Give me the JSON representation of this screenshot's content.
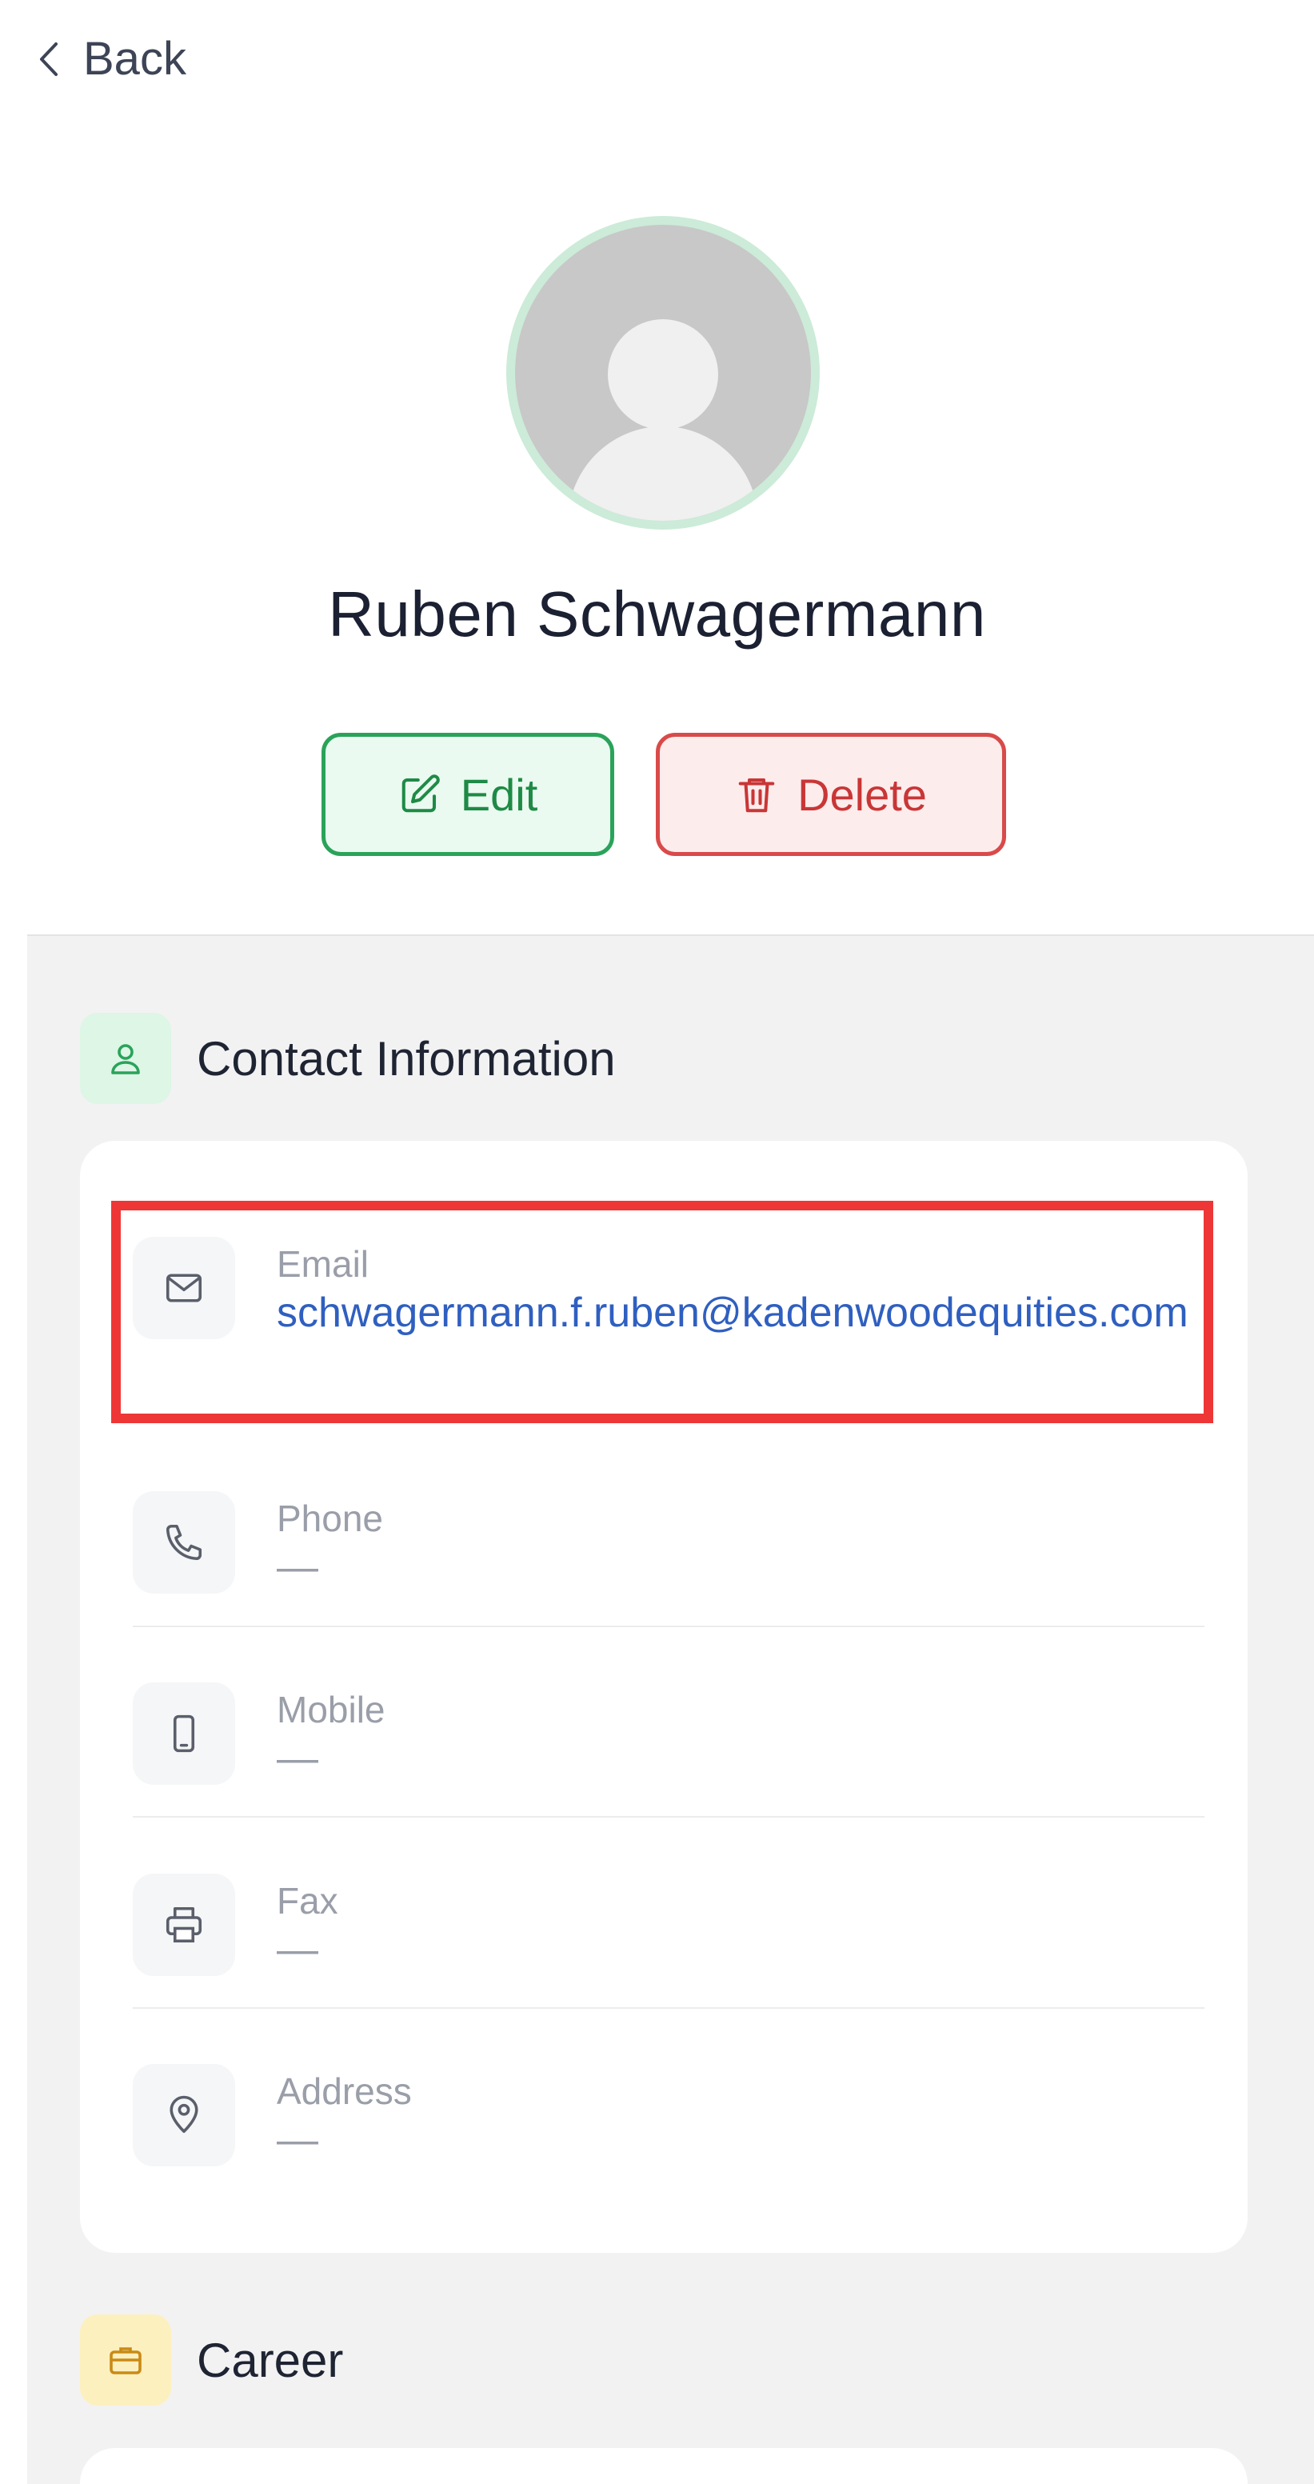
{
  "nav": {
    "back_label": "Back"
  },
  "profile": {
    "name": "Ruben Schwagermann"
  },
  "actions": {
    "edit_label": "Edit",
    "delete_label": "Delete"
  },
  "contact": {
    "title": "Contact Information",
    "rows": [
      {
        "label": "Email",
        "value": "schwagermann.f.ruben@kadenwoodequities.com",
        "icon": "mail-icon"
      },
      {
        "label": "Phone",
        "value": "—",
        "icon": "phone-icon"
      },
      {
        "label": "Mobile",
        "value": "—",
        "icon": "mobile-icon"
      },
      {
        "label": "Fax",
        "value": "—",
        "icon": "printer-icon"
      },
      {
        "label": "Address",
        "value": "—",
        "icon": "map-pin-icon"
      }
    ]
  },
  "career": {
    "title": "Career"
  },
  "colors": {
    "accent_green": "#2aa35a",
    "danger_red": "#d94a4a",
    "link_blue": "#2f5fc0",
    "highlight_red": "#ee3636"
  }
}
